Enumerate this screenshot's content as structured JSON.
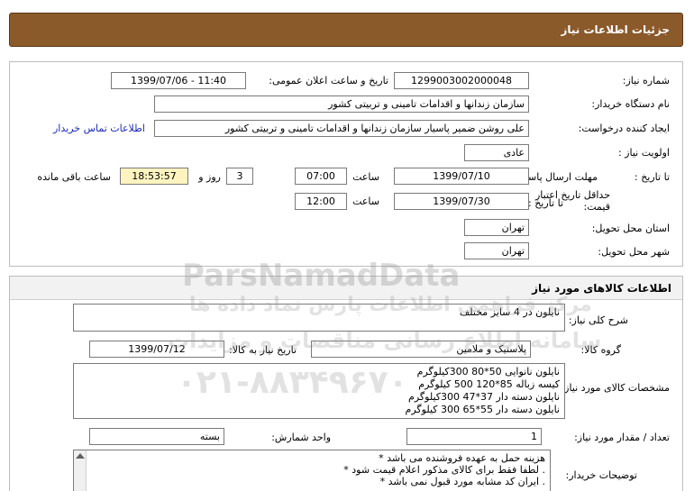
{
  "header": {
    "title": "جزئیات اطلاعات نیاز"
  },
  "need_info": {
    "need_number_label": "شماره نیاز:",
    "need_number": "1299003002000048",
    "announce_label": "تاریخ و ساعت اعلان عمومی:",
    "announce_value": "1399/07/06 - 11:40",
    "buyer_org_label": "نام دستگاه خریدار:",
    "buyer_org": "سازمان زندانها و اقدامات تامینی و تربیتی کشور",
    "requester_label": "ایجاد کننده درخواست:",
    "requester": "علی روشن ضمیر پاسیار سازمان زندانها و اقدامات تامینی و تربیتی کشور",
    "contact_link": "اطلاعات تماس خریدار",
    "priority_label": "اولویت نیاز :",
    "priority": "عادی",
    "deadline_label": "مهلت ارسال پاسخ:",
    "until_date_label": "تا تاریخ :",
    "deadline_date": "1399/07/10",
    "time_label": "ساعت",
    "deadline_time": "07:00",
    "days_value": "3",
    "days_and_label": "روز و",
    "remaining_time": "18:53:57",
    "remaining_label": "ساعت باقی مانده",
    "price_validity_label": "حداقل تاریخ اعتبار قیمت:",
    "price_until_label": "تا تاریخ :",
    "price_date": "1399/07/30",
    "price_time_label": "ساعت",
    "price_time": "12:00",
    "province_label": "استان محل تحویل:",
    "province": "تهران",
    "city_label": "شهر محل تحویل:",
    "city": "تهران"
  },
  "goods": {
    "section_title": "اطلاعات کالاهای مورد نیاز",
    "general_desc_label": "شرح کلی نیاز:",
    "general_desc": "نایلون در 4 سایز مختلف",
    "group_label": "گروه کالا:",
    "group_value": "پلاستیک و ملامین",
    "need_date_label": "تاریخ نیاز به کالا:",
    "need_date": "1399/07/12",
    "specs_label": "مشخصات کالای مورد نیاز:",
    "specs": [
      "نایلون نانوایی 50*80  300کیلوگرم",
      "کیسه زباله 85*120 500 کیلوگرم",
      "نایلون دسته دار 37*47 300کیلوگرم",
      "نایلون دسته دار 55*65  300 کیلوگرم"
    ],
    "unit_label": "واحد شمارش:",
    "unit_value": "بسته",
    "quantity_label": "تعداد / مقدار مورد نیاز:",
    "quantity_value": "1",
    "buyer_notes_label": "توضیحات خریدار:",
    "buyer_notes": [
      "هزینه حمل به عهده فروشنده می باشد *",
      ". لطفا فقط برای کالای مذکور اعلام قیمت شود *",
      ". ایران کد مشابه مورد قبول نمی باشد *"
    ]
  },
  "watermark": {
    "brand": "ParsNamadData",
    "persian": "مرکز فراهمی اطلاعات پارس نماد داده ها",
    "persian2": "سامانه اطلاع رسانی مناقصات و مزایدات",
    "phone": "۰۲۱-۸۸۳۴۹۶۷۰"
  }
}
